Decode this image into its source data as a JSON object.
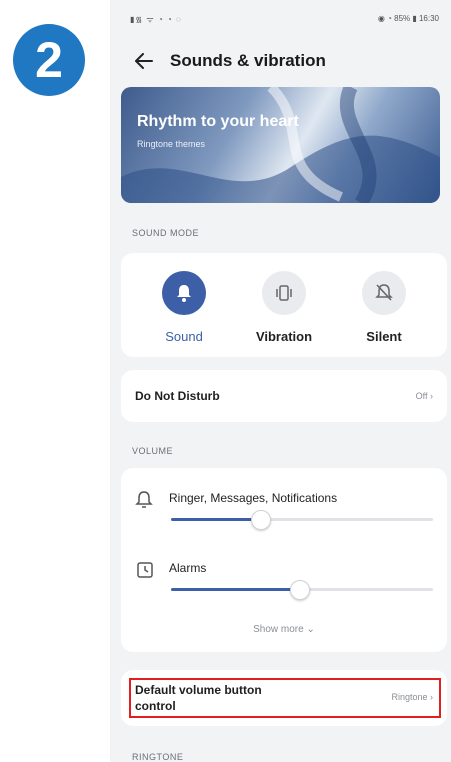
{
  "step_badge": "2",
  "status": {
    "left": "▮᯾ ᯤ ◔ ◔ ◌",
    "right": "◉ ◔ 85% ▮ 16:30"
  },
  "header": {
    "title": "Sounds & vibration"
  },
  "banner": {
    "title": "Rhythm to your heart",
    "subtitle": "Ringtone themes"
  },
  "sound_mode": {
    "section_label": "SOUND MODE",
    "modes": [
      {
        "label": "Sound",
        "active": true,
        "icon": "bell-icon"
      },
      {
        "label": "Vibration",
        "active": false,
        "icon": "vibration-icon"
      },
      {
        "label": "Silent",
        "active": false,
        "icon": "bell-off-icon"
      }
    ]
  },
  "dnd": {
    "title": "Do Not Disturb",
    "value": "Off"
  },
  "volume": {
    "section_label": "VOLUME",
    "items": [
      {
        "label": "Ringer, Messages, Notifications",
        "icon": "bell-icon",
        "level": 0.34
      },
      {
        "label": "Alarms",
        "icon": "alarm-clock-icon",
        "level": 0.49
      }
    ],
    "show_more": "Show more"
  },
  "default_volume": {
    "title_line1": "Default volume button",
    "title_line2": "control",
    "value": "Ringtone"
  },
  "ringtone": {
    "section_label": "RINGTONE"
  },
  "colors": {
    "accent": "#3c5fa7",
    "badge": "#1f78c1",
    "highlight": "#e02020"
  }
}
